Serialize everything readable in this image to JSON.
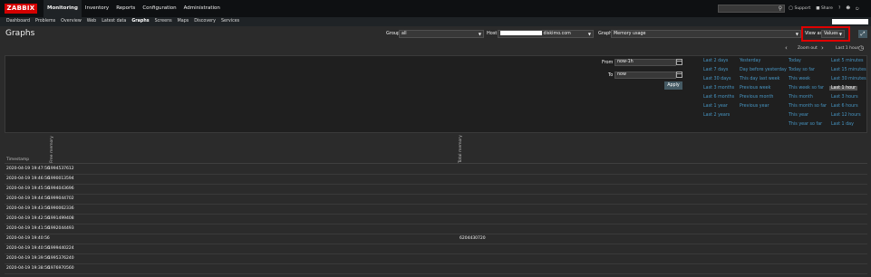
{
  "app": {
    "logo": "ZABBIX"
  },
  "main_menu": [
    "Monitoring",
    "Inventory",
    "Reports",
    "Configuration",
    "Administration"
  ],
  "top_right": {
    "support": "Support",
    "share": "Share",
    "help": "?",
    "user": "user",
    "logout": "logout"
  },
  "sub_menu": [
    "Dashboard",
    "Problems",
    "Overview",
    "Web",
    "Latest data",
    "Graphs",
    "Screens",
    "Maps",
    "Discovery",
    "Services"
  ],
  "page": {
    "title": "Graphs"
  },
  "filter": {
    "group_label": "Group",
    "group_value": "all",
    "host_label": "Host",
    "host_value": "diskimo.com",
    "graph_label": "Graph",
    "graph_value": "Memory usage",
    "view_label": "View as",
    "view_value": "Values"
  },
  "nav": {
    "zoom_out": "Zoom out",
    "last_hour": "Last 1 hour"
  },
  "time": {
    "from_label": "From",
    "from_value": "now-1h",
    "to_label": "To",
    "to_value": "now",
    "apply_label": "Apply"
  },
  "quick_ranges": {
    "col1": [
      "Last 2 days",
      "Last 7 days",
      "Last 30 days",
      "Last 3 months",
      "Last 6 months",
      "Last 1 year",
      "Last 2 years"
    ],
    "col2": [
      "Yesterday",
      "Day before yesterday",
      "This day last week",
      "Previous week",
      "Previous month",
      "Previous year"
    ],
    "col3": [
      "Today",
      "Today so far",
      "This week",
      "This week so far",
      "This month",
      "This month so far",
      "This year",
      "This year so far"
    ],
    "col4": [
      "Last 5 minutes",
      "Last 15 minutes",
      "Last 30 minutes",
      "Last 1 hour",
      "Last 3 hours",
      "Last 6 hours",
      "Last 12 hours",
      "Last 1 day"
    ],
    "selected": "Last 1 hour"
  },
  "table": {
    "headers": {
      "timestamp": "Timestamp",
      "col1": "Free memory",
      "col2": "Total memory"
    },
    "rows": [
      {
        "ts": "2020-04-19 19:47:56",
        "free": "1994537612",
        "total": ""
      },
      {
        "ts": "2020-04-19 19:46:56",
        "free": "1990013594",
        "total": ""
      },
      {
        "ts": "2020-04-19 19:45:56",
        "free": "1994043696",
        "total": ""
      },
      {
        "ts": "2020-04-19 19:44:56",
        "free": "1999044702",
        "total": ""
      },
      {
        "ts": "2020-04-19 19:43:56",
        "free": "1990062336",
        "total": ""
      },
      {
        "ts": "2020-04-19 19:42:56",
        "free": "1991499408",
        "total": ""
      },
      {
        "ts": "2020-04-19 19:41:56",
        "free": "1992044493",
        "total": ""
      },
      {
        "ts": "2020-04-19 19:40:56",
        "free": "",
        "total": "6204430720"
      },
      {
        "ts": "2020-04-19 19:40:56",
        "free": "1999440224",
        "total": ""
      },
      {
        "ts": "2020-04-19 19:39:56",
        "free": "1995376240",
        "total": ""
      },
      {
        "ts": "2020-04-19 19:38:56",
        "free": "1976970560",
        "total": ""
      }
    ]
  },
  "colors": {
    "accent_red": "#d40000",
    "link_blue": "#4796c4",
    "highlight_box": "#e00000"
  }
}
